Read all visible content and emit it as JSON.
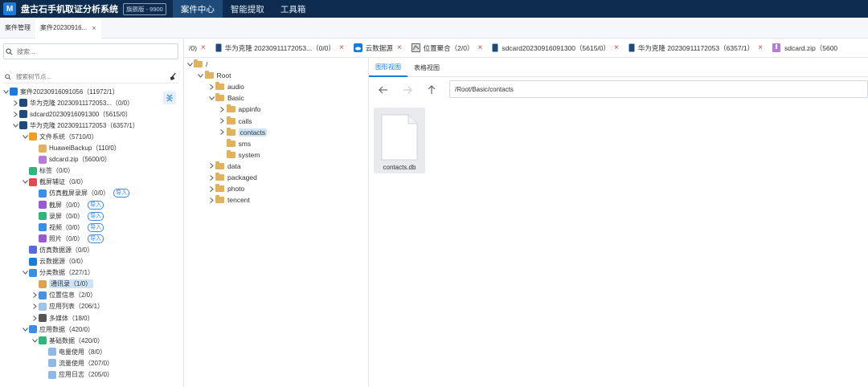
{
  "app": {
    "logo_letter": "M",
    "title": "盘古石手机取证分析系统",
    "edition": "旗舰版 - 9900",
    "nav": [
      "案件中心",
      "智能提取",
      "工具箱"
    ],
    "nav_active": 0
  },
  "case_tabs": [
    {
      "label": "案件管理",
      "active": false
    },
    {
      "label": "案件20230916...",
      "active": true,
      "close": "×"
    }
  ],
  "left": {
    "search_placeholder": "搜索...",
    "tree_search_placeholder": "搜索树节点...",
    "tree": [
      {
        "indent": 0,
        "arrow": "v",
        "icon_color": "#1d7bd8",
        "label": "案件20230916091056（11972/1）"
      },
      {
        "indent": 1,
        "arrow": ">",
        "icon_color": "#1e4b7a",
        "label": "华为克隆 20230911172053...（0/0）"
      },
      {
        "indent": 1,
        "arrow": ">",
        "icon_color": "#1e4b7a",
        "label": "sdcard20230916091300（5615/0）"
      },
      {
        "indent": 1,
        "arrow": "v",
        "icon_color": "#1e4b7a",
        "label": "华为克隆 20230911172053（6357/1）"
      },
      {
        "indent": 2,
        "arrow": "v",
        "icon_color": "#f0a020",
        "label": "文件系统（5710/0）"
      },
      {
        "indent": 3,
        "arrow": "",
        "icon_color": "#e0b15f",
        "label": "HuaweiBackup（110/0）"
      },
      {
        "indent": 3,
        "arrow": "",
        "icon_color": "#b57bd6",
        "label": "sdcard.zip（5600/0）"
      },
      {
        "indent": 2,
        "arrow": "",
        "icon_color": "#2eb67d",
        "label": "标签（0/0）"
      },
      {
        "indent": 2,
        "arrow": "v",
        "icon_color": "#e5484d",
        "label": "截屏辅证（0/0）"
      },
      {
        "indent": 3,
        "arrow": "",
        "icon_color": "#3a8ee6",
        "label": "仿真截屏录屏（0/0）",
        "import": "导入"
      },
      {
        "indent": 3,
        "arrow": "",
        "icon_color": "#9b59d6",
        "label": "截屏（0/0）",
        "import": "导入"
      },
      {
        "indent": 3,
        "arrow": "",
        "icon_color": "#2eb67d",
        "label": "录屏（0/0）",
        "import": "导入"
      },
      {
        "indent": 3,
        "arrow": "",
        "icon_color": "#3a8ee6",
        "label": "视频（0/0）",
        "import": "导入"
      },
      {
        "indent": 3,
        "arrow": "",
        "icon_color": "#9b59d6",
        "label": "照片（0/0）",
        "import": "导入"
      },
      {
        "indent": 2,
        "arrow": "",
        "icon_color": "#5b6bd6",
        "label": "仿真数据源（0/0）"
      },
      {
        "indent": 2,
        "arrow": "",
        "icon_color": "#1d7bd8",
        "label": "云数据源（0/0）"
      },
      {
        "indent": 2,
        "arrow": "v",
        "icon_color": "#3a8ee6",
        "label": "分类数据（227/1）"
      },
      {
        "indent": 3,
        "arrow": "",
        "icon_color": "#e0a050",
        "label": "通讯录（1/0）",
        "hl": true
      },
      {
        "indent": 3,
        "arrow": ">",
        "icon_color": "#4a90e2",
        "label": "位置信息（2/0）"
      },
      {
        "indent": 3,
        "arrow": ">",
        "icon_color": "#a0c4e8",
        "label": "应用列表（206/1）"
      },
      {
        "indent": 3,
        "arrow": ">",
        "icon_color": "#555555",
        "label": "多媒体（18/0）"
      },
      {
        "indent": 2,
        "arrow": "v",
        "icon_color": "#3a8ee6",
        "label": "应用数据（420/0）"
      },
      {
        "indent": 3,
        "arrow": "v",
        "icon_color": "#2eb67d",
        "label": "基础数据（420/0）"
      },
      {
        "indent": 4,
        "arrow": "",
        "icon_color": "#8fb8e6",
        "label": "电量使用（8/0）"
      },
      {
        "indent": 4,
        "arrow": "",
        "icon_color": "#8fb8e6",
        "label": "流量使用（207/0）"
      },
      {
        "indent": 4,
        "arrow": "",
        "icon_color": "#8fb8e6",
        "label": "应用日志（205/0）"
      }
    ]
  },
  "open_tabs": [
    {
      "label": "/0)",
      "icon": "",
      "close": "×"
    },
    {
      "label": "华为克隆 20230911172053...（0/0）",
      "icon": "phone",
      "close": "×"
    },
    {
      "label": "云数据源",
      "icon": "cloud",
      "close": "×"
    },
    {
      "label": "位置聚合（2/0）",
      "icon": "map",
      "close": "×"
    },
    {
      "label": "sdcard20230916091300（5615/0）",
      "icon": "phone",
      "close": "×"
    },
    {
      "label": "华为克隆 20230911172053（6357/1）",
      "icon": "phone",
      "close": "×"
    },
    {
      "label": "sdcard.zip（5600",
      "icon": "zip",
      "close": ""
    }
  ],
  "folders": [
    {
      "indent": 0,
      "arrow": "v",
      "label": "/"
    },
    {
      "indent": 1,
      "arrow": "v",
      "label": "Root"
    },
    {
      "indent": 2,
      "arrow": ">",
      "label": "audio"
    },
    {
      "indent": 2,
      "arrow": "v",
      "label": "Basic"
    },
    {
      "indent": 3,
      "arrow": ">",
      "label": "appinfo"
    },
    {
      "indent": 3,
      "arrow": ">",
      "label": "calls"
    },
    {
      "indent": 3,
      "arrow": ">",
      "label": "contacts",
      "hl": true
    },
    {
      "indent": 3,
      "arrow": "",
      "label": "sms"
    },
    {
      "indent": 3,
      "arrow": "",
      "label": "system"
    },
    {
      "indent": 2,
      "arrow": ">",
      "label": "data"
    },
    {
      "indent": 2,
      "arrow": ">",
      "label": "packaged"
    },
    {
      "indent": 2,
      "arrow": ">",
      "label": "photo"
    },
    {
      "indent": 2,
      "arrow": ">",
      "label": "tencent"
    }
  ],
  "content": {
    "view_tabs": [
      "图形视图",
      "表格视图"
    ],
    "active_view": 0,
    "path": "/Root/Basic/contacts",
    "files": [
      {
        "name": "contacts.db"
      }
    ]
  }
}
